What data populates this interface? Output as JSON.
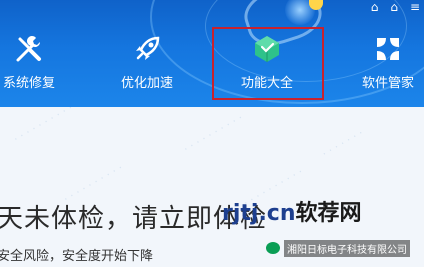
{
  "nav": {
    "items": [
      {
        "label": "系统修复",
        "icon": "wrench-screwdriver-icon"
      },
      {
        "label": "优化加速",
        "icon": "rocket-icon"
      },
      {
        "label": "功能大全",
        "icon": "cube-icon"
      },
      {
        "label": "软件管家",
        "icon": "grid-flower-icon"
      }
    ]
  },
  "window": {
    "skin_icon": "⌂",
    "shirt_icon": "⌂",
    "menu_icon": "≡"
  },
  "main": {
    "headline": "天未体检，请立即体检",
    "subline": "安全风险，安全度开始下降"
  },
  "overlay": {
    "site_url": "rjtj.cn",
    "site_name": "软荐网",
    "wechat_account": "湘阳日标电子科技有限公司"
  },
  "colors": {
    "header": "#1576df",
    "highlight": "#c8222e",
    "accent_green": "#2ec28a"
  }
}
